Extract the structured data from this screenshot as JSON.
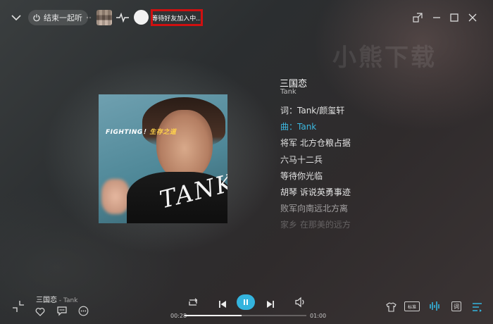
{
  "topbar": {
    "listen_together_label": "结束一起听",
    "waiting_text": "等待好友加入中..."
  },
  "watermark": "小熊下载",
  "album": {
    "cover_text": "FIGHTING！",
    "cover_subtext": "生存之道",
    "cover_logo": "TANK"
  },
  "song": {
    "title": "三国恋",
    "artist": "Tank"
  },
  "lyrics": [
    "词：Tank/颜玺轩",
    "曲：Tank",
    "将军 北方仓粮占据",
    "六马十二兵",
    "等待你光临",
    "胡琴 诉说英勇事迹",
    "败军向南远北方离",
    "家乡 在那美的远方"
  ],
  "active_lyric_index": 1,
  "player": {
    "title": "三国恋",
    "artist_sep": " - Tank",
    "current_time": "00:28",
    "total_time": "01:00",
    "progress": 0.47,
    "quality_label": "标准",
    "lyric_label": "词"
  },
  "colors": {
    "accent": "#34b4de",
    "highlight_border": "#d01010"
  },
  "icons": {
    "collapse": "chevron-down-icon",
    "power": "power-icon",
    "pulse": "pulse-icon",
    "mini_mode": "mini-mode-icon",
    "minimize": "minimize-icon",
    "maximize": "maximize-icon",
    "close": "close-icon",
    "shrink": "shrink-icon",
    "like": "heart-icon",
    "comment": "comment-icon",
    "more": "more-icon",
    "loop": "loop-icon",
    "prev": "previous-icon",
    "pause": "pause-icon",
    "next": "next-icon",
    "volume": "volume-icon",
    "skin": "shirt-icon",
    "effect": "sound-effect-icon",
    "playlist": "playlist-icon"
  }
}
